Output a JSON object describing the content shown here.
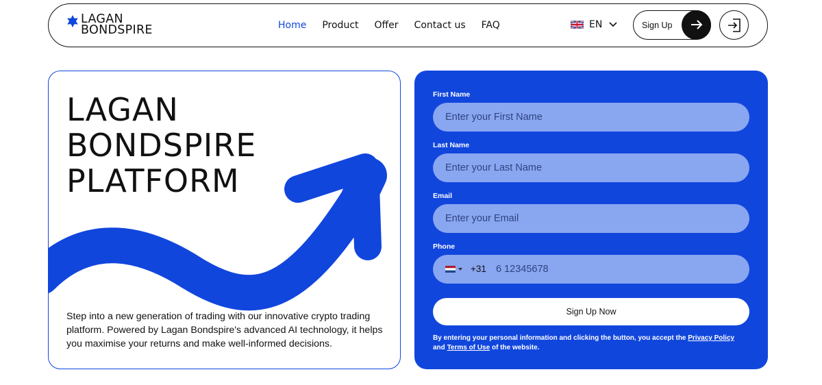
{
  "brand": {
    "line1": "LAGAN",
    "line2": "BONDSPIRE",
    "colors": {
      "primary": "#1146dd",
      "field": "#89a6f0",
      "dark": "#111111"
    }
  },
  "nav": {
    "items": [
      {
        "label": "Home",
        "active": true
      },
      {
        "label": "Product"
      },
      {
        "label": "Offer"
      },
      {
        "label": "Contact us"
      },
      {
        "label": "FAQ"
      }
    ]
  },
  "language": {
    "flag": "uk-flag-icon",
    "label": "EN"
  },
  "header": {
    "signup_label": "Sign Up"
  },
  "hero": {
    "title_lines": [
      "LAGAN",
      "BONDSPIRE",
      "PLATFORM"
    ],
    "description": "Step into a new generation of trading with our innovative crypto trading platform. Powered by Lagan Bondspire's advanced AI technology, it helps you maximise your returns and make well-informed decisions."
  },
  "form": {
    "first_name": {
      "label": "First Name",
      "placeholder": "Enter your First Name"
    },
    "last_name": {
      "label": "Last Name",
      "placeholder": "Enter your Last Name"
    },
    "email": {
      "label": "Email",
      "placeholder": "Enter your Email"
    },
    "phone": {
      "label": "Phone",
      "country_flag": "netherlands-flag-icon",
      "code": "+31",
      "placeholder": "6 12345678"
    },
    "submit_label": "Sign Up Now",
    "disclaimer": {
      "pre": "By entering your personal information and clicking the button, you accept the ",
      "privacy_link": "Privacy Policy",
      "mid": " and ",
      "terms_link": "Terms of Use",
      "post": " of the website."
    }
  }
}
